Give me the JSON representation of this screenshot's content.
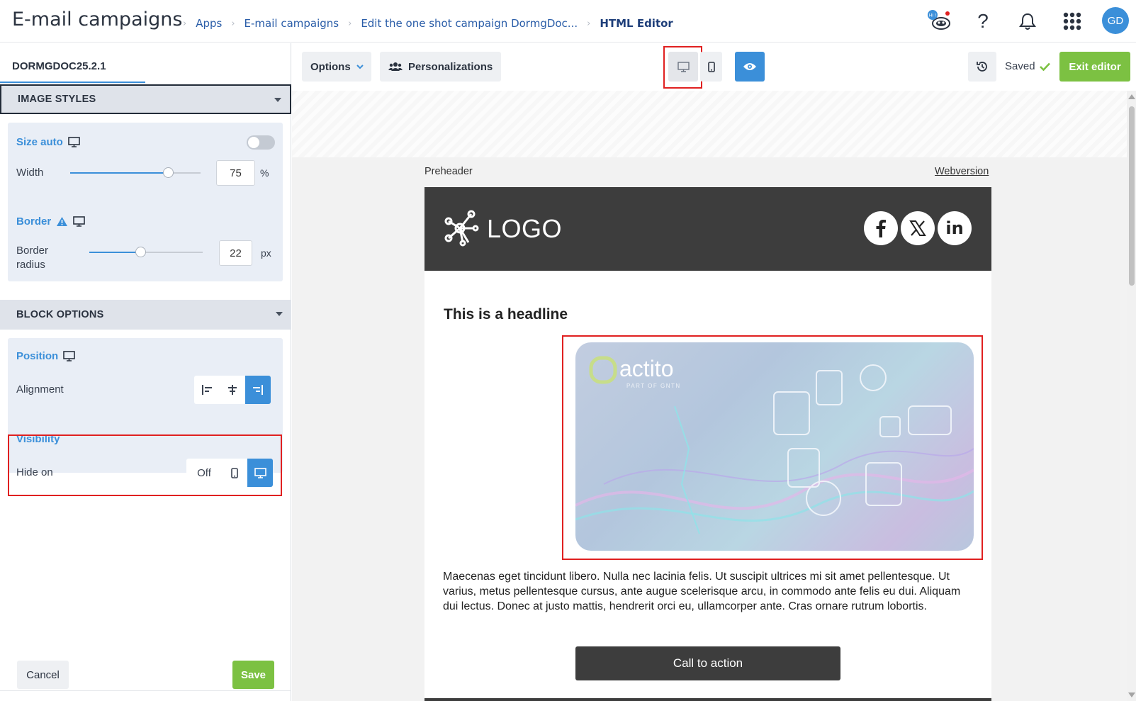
{
  "header": {
    "app_title": "E-mail campaigns",
    "breadcrumbs": [
      "Apps",
      "E-mail campaigns",
      "Edit the one shot campaign DormgDoc..."
    ],
    "current": "HTML Editor",
    "assistant_badge": "Hi !",
    "help": "?",
    "avatar_initials": "GD"
  },
  "left_panel": {
    "campaign_tab": "DORMGDOC25.2.1",
    "image_styles": {
      "title": "IMAGE STYLES",
      "size_auto_label": "Size auto",
      "size_auto_on": false,
      "width_label": "Width",
      "width_value": "75",
      "width_unit": "%",
      "width_fraction": 0.75,
      "border_label": "Border",
      "radius_label_1": "Border",
      "radius_label_2": "radius",
      "radius_value": "22",
      "radius_unit": "px",
      "radius_fraction": 0.45
    },
    "block_options": {
      "title": "BLOCK OPTIONS",
      "position_label": "Position",
      "alignment_label": "Alignment",
      "alignment_selected": "right",
      "visibility_label": "Visibility",
      "hide_on_label": "Hide on",
      "hide_off": "Off",
      "hide_selected": "desktop"
    },
    "cancel": "Cancel",
    "save": "Save"
  },
  "toolbar": {
    "options": "Options",
    "personalizations": "Personalizations",
    "saved": "Saved",
    "exit_editor": "Exit editor"
  },
  "email": {
    "preheader": "Preheader",
    "webversion": "Webversion",
    "logo": "LOGO",
    "social": [
      "facebook-icon",
      "x-icon",
      "linkedin-icon"
    ],
    "headline": "This is a headline",
    "hero_brand": "actito",
    "hero_tagline": "PART OF GNTN",
    "paragraph": "Maecenas eget tincidunt libero. Nulla nec lacinia felis. Ut suscipit ultrices mi sit amet pellentesque. Ut varius, metus pellentesque cursus, ante augue scelerisque arcu, in commodo ante felis eu dui. Aliquam dui lectus. Donec at justo mattis, hendrerit orci eu, ullamcorper ante. Cras ornare rutrum lobortis.",
    "cta": "Call to action"
  },
  "colors": {
    "accent": "#3b8fd9",
    "save_green": "#7cc142",
    "highlight_red": "#e02020",
    "email_dark": "#3d3d3d"
  }
}
